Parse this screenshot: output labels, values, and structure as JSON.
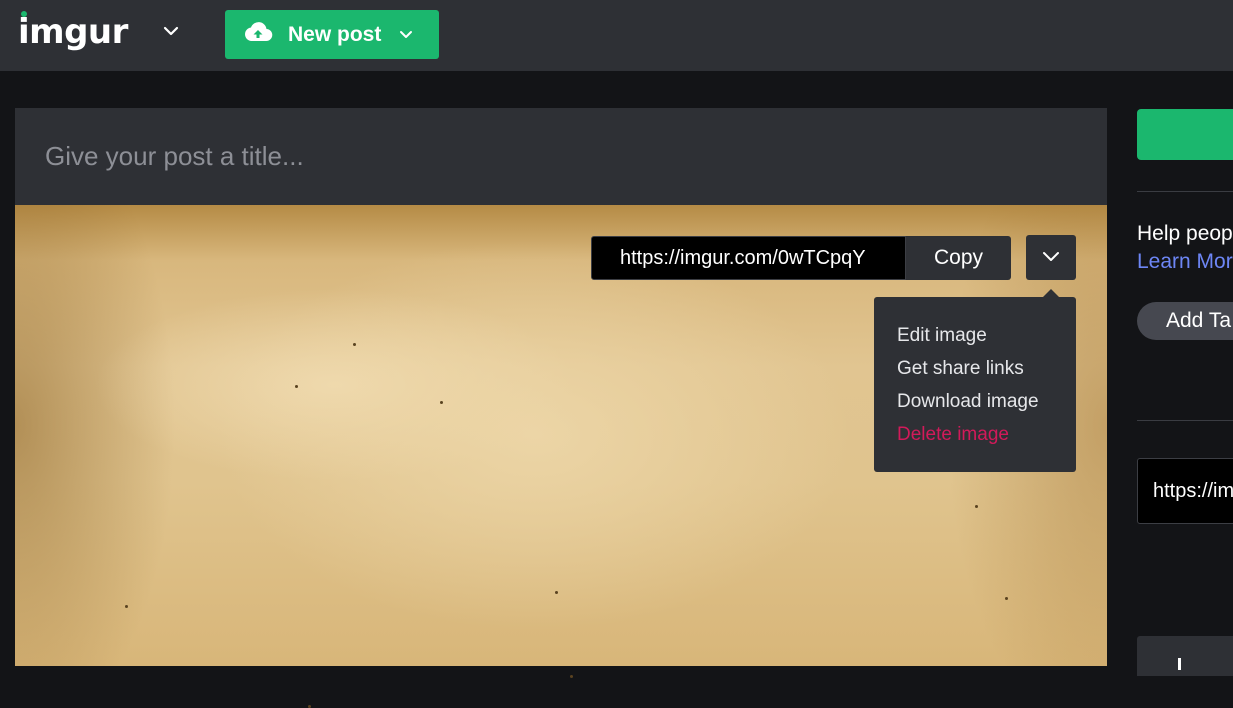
{
  "header": {
    "logo_text": "imgur",
    "new_post_label": "New post"
  },
  "post": {
    "title_placeholder": "Give your post a title..."
  },
  "image_toolbar": {
    "url": "https://imgur.com/0wTCpqY",
    "copy_label": "Copy"
  },
  "image_menu": {
    "items": [
      {
        "label": "Edit image"
      },
      {
        "label": "Get share links"
      },
      {
        "label": "Download image"
      },
      {
        "label": "Delete image"
      }
    ]
  },
  "sidebar": {
    "help_text": "Help peop",
    "learn_more": "Learn Mor",
    "add_tags_label": "Add Ta",
    "link_value": "https://im"
  },
  "colors": {
    "brand_green": "#1bb76e",
    "header_bg": "#2e3035",
    "page_bg": "#131417",
    "danger": "#d21a5a",
    "link": "#6d86f5"
  },
  "icons": {
    "logo_menu": "chevron-down-icon",
    "new_post": "cloud-upload-icon",
    "new_post_menu": "chevron-down-icon",
    "image_menu": "chevron-down-icon"
  }
}
